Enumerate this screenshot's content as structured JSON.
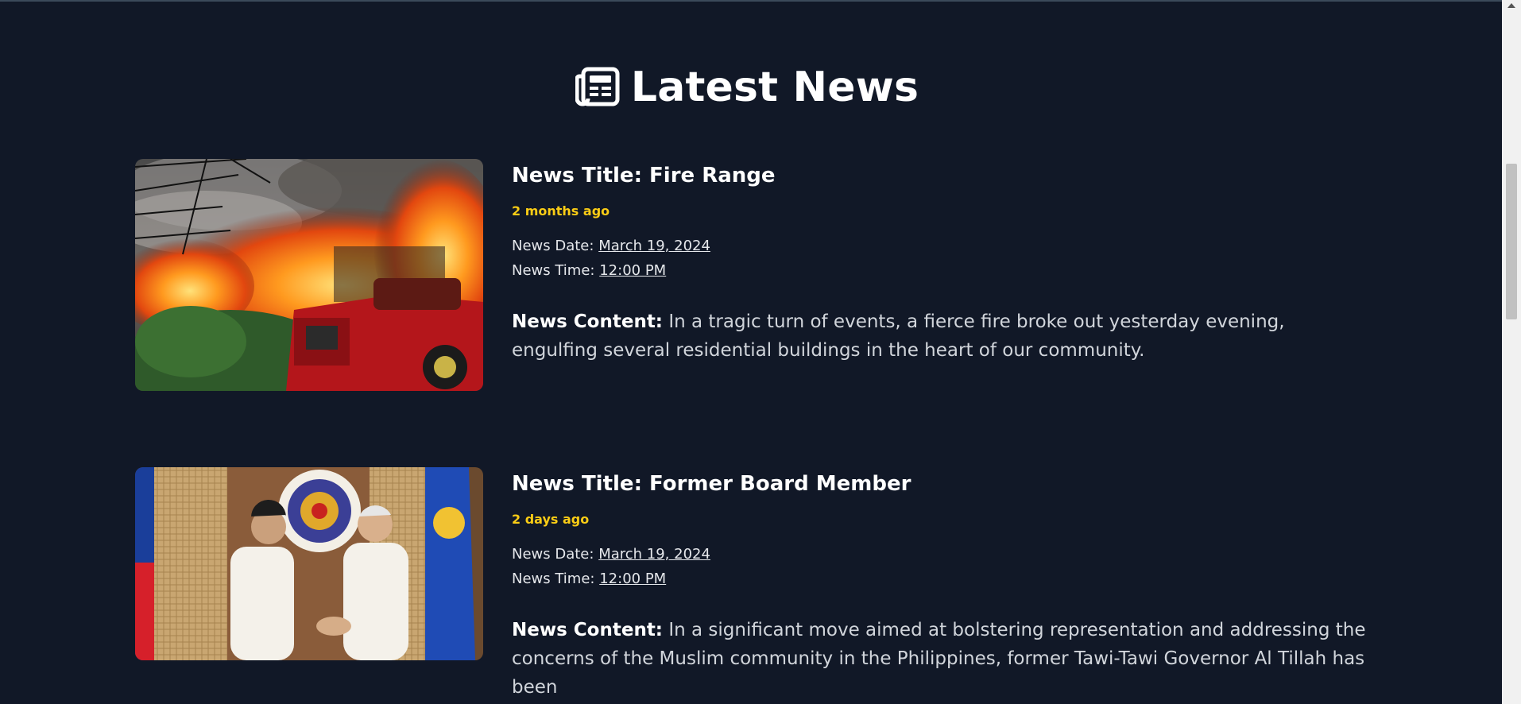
{
  "header": {
    "icon": "newspaper-icon",
    "title": "Latest News"
  },
  "news": [
    {
      "image": "fire-scene-image",
      "title_label": "News Title:",
      "title": "Fire Range",
      "ago": "2 months ago",
      "date_label": "News Date:",
      "date": "March 19, 2024",
      "time_label": "News Time:",
      "time": "12:00 PM",
      "content_label": "News Content:",
      "content": "In a tragic turn of events, a fierce fire broke out yesterday evening, engulfing several residential buildings in the heart of our community."
    },
    {
      "image": "handshake-ceremony-image",
      "title_label": "News Title:",
      "title": "Former Board Member",
      "ago": "2 days ago",
      "date_label": "News Date:",
      "date": "March 19, 2024",
      "time_label": "News Time:",
      "time": "12:00 PM",
      "content_label": "News Content:",
      "content": "In a significant move aimed at bolstering representation and addressing the concerns of the Muslim community in the Philippines, former Tawi-Tawi Governor Al Tillah has been"
    }
  ],
  "colors": {
    "background": "#111827",
    "accent": "#facc15",
    "text": "#e5e7eb"
  }
}
